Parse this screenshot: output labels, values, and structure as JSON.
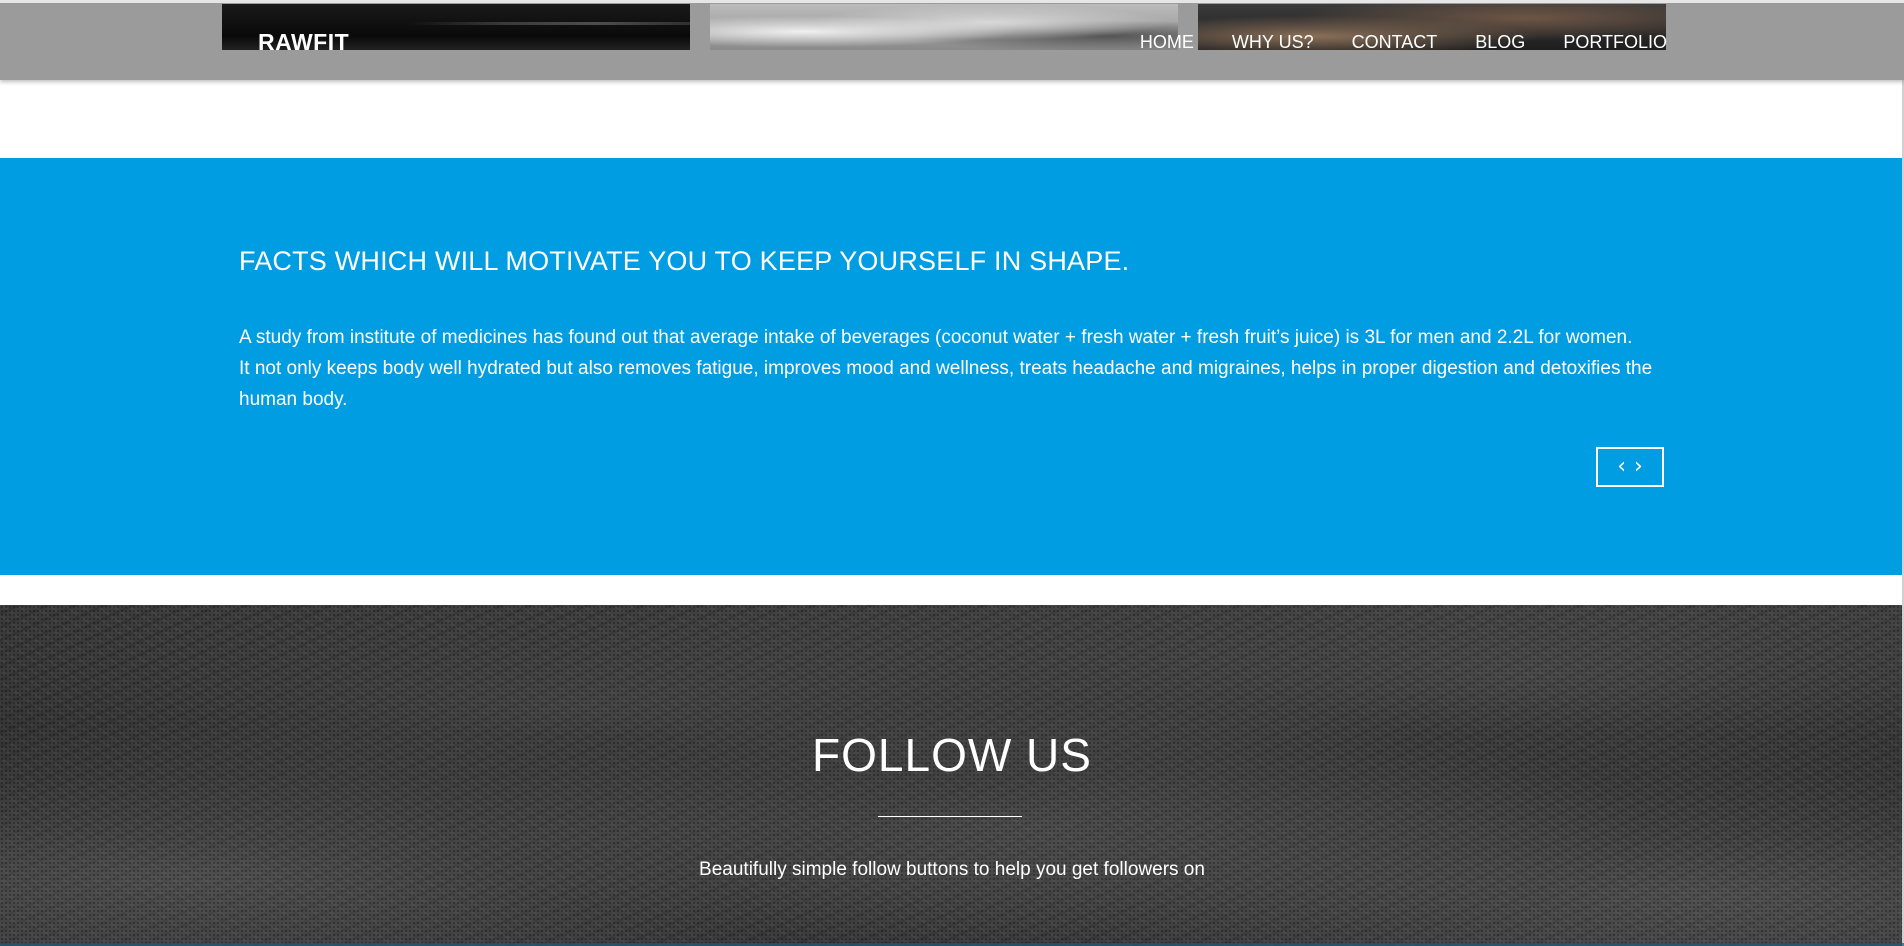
{
  "header": {
    "brand": "RAWFIT",
    "nav": [
      {
        "label": "HOME"
      },
      {
        "label": "WHY US?"
      },
      {
        "label": "CONTACT"
      },
      {
        "label": "BLOG"
      },
      {
        "label": "PORTFOLIO"
      }
    ]
  },
  "facts": {
    "title": "FACTS WHICH WILL MOTIVATE YOU TO KEEP YOURSELF IN SHAPE.",
    "paragraph_1": "A study from institute of medicines has found out that average intake of beverages (coconut water + fresh water + fresh fruit’s juice) is 3L for men and 2.2L for women.",
    "paragraph_2": "It not only keeps body well hydrated but also removes fatigue, improves mood and wellness, treats headache and migraines, helps in proper digestion and detoxifies the human body.",
    "prev_icon": "chevron-left-icon",
    "next_icon": "chevron-right-icon",
    "prev_glyph": "‹",
    "next_glyph": "›"
  },
  "follow": {
    "title": "FOLLOW US",
    "text": "Beautifully simple follow buttons to help you get followers on"
  },
  "colors": {
    "facts_background": "#009de2",
    "header_background": "#9b9b9b",
    "text": "#ffffff"
  }
}
